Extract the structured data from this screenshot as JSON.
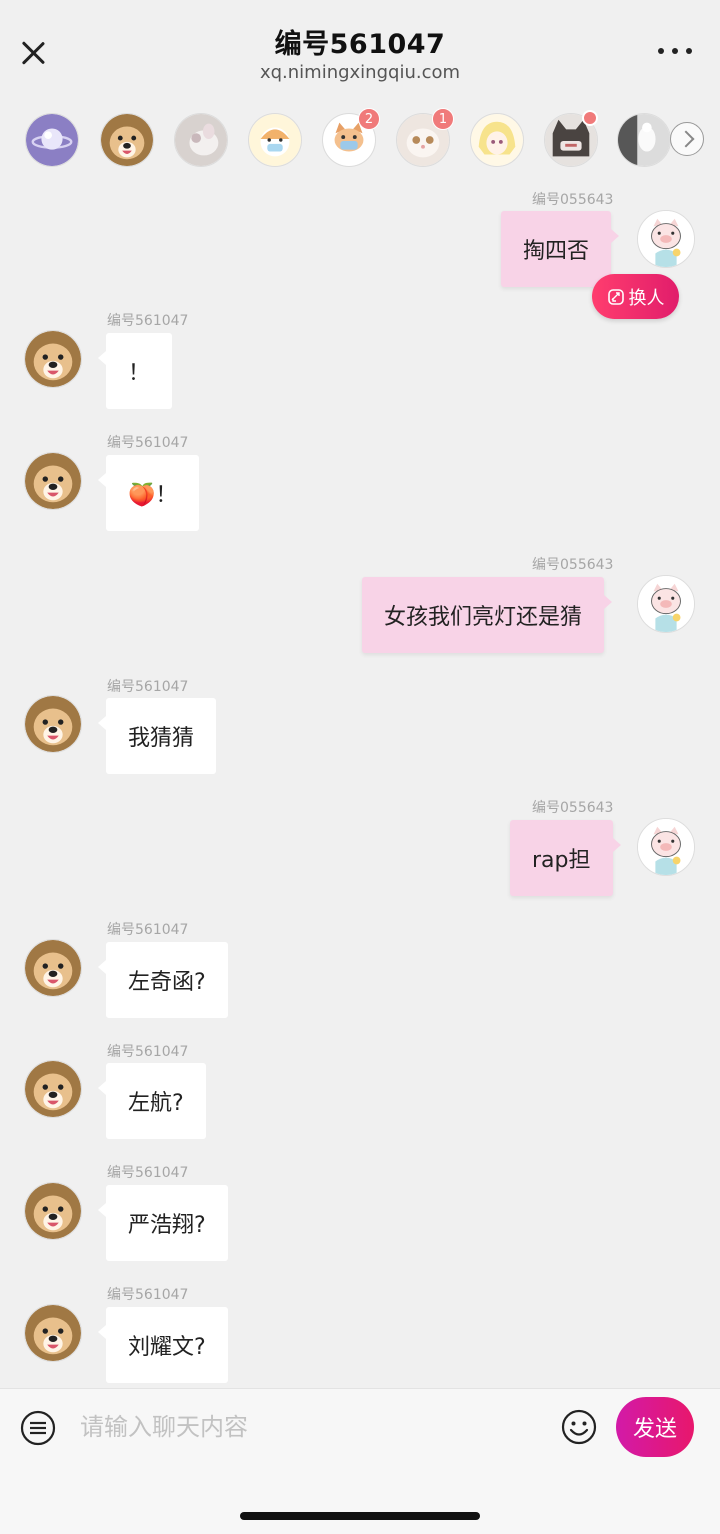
{
  "header": {
    "title": "编号561047",
    "subtitle": "xq.nimingxingqiu.com"
  },
  "contacts": [
    {
      "avatar": "planet-icon",
      "badge": null
    },
    {
      "avatar": "dog-avatar",
      "badge": null
    },
    {
      "avatar": "cat-photo-avatar",
      "badge": null
    },
    {
      "avatar": "cartoon-girl-avatar",
      "badge": null
    },
    {
      "avatar": "cat-mask-avatar",
      "badge": "2"
    },
    {
      "avatar": "kitten-avatar",
      "badge": "1"
    },
    {
      "avatar": "anime-girl-avatar",
      "badge": null
    },
    {
      "avatar": "dark-cat-avatar",
      "badge": "dot"
    },
    {
      "avatar": "figure-avatar",
      "badge": null
    }
  ],
  "messages": [
    {
      "direction": "out",
      "sender": "编号055643",
      "text": "掏四否"
    },
    {
      "direction": "in",
      "sender": "编号561047",
      "text": "！"
    },
    {
      "direction": "in",
      "sender": "编号561047",
      "text": "🍑！"
    },
    {
      "direction": "out",
      "sender": "编号055643",
      "text": "女孩我们亮灯还是猜"
    },
    {
      "direction": "in",
      "sender": "编号561047",
      "text": "我猜猜"
    },
    {
      "direction": "out",
      "sender": "编号055643",
      "text": "rap担"
    },
    {
      "direction": "in",
      "sender": "编号561047",
      "text": "左奇函?"
    },
    {
      "direction": "in",
      "sender": "编号561047",
      "text": "左航?"
    },
    {
      "direction": "in",
      "sender": "编号561047",
      "text": "严浩翔?"
    },
    {
      "direction": "in",
      "sender": "编号561047",
      "text": "刘耀文?"
    }
  ],
  "swap_button": {
    "label": "换人",
    "icon": "swap-icon"
  },
  "input": {
    "placeholder": "请输入聊天内容",
    "value": ""
  },
  "send_button": {
    "label": "发送"
  },
  "colors": {
    "outgoing_bubble": "#f8d3e7",
    "incoming_bubble": "#ffffff",
    "accent_start": "#d21aa8",
    "accent_end": "#e8176c",
    "badge": "#f07a7a"
  }
}
